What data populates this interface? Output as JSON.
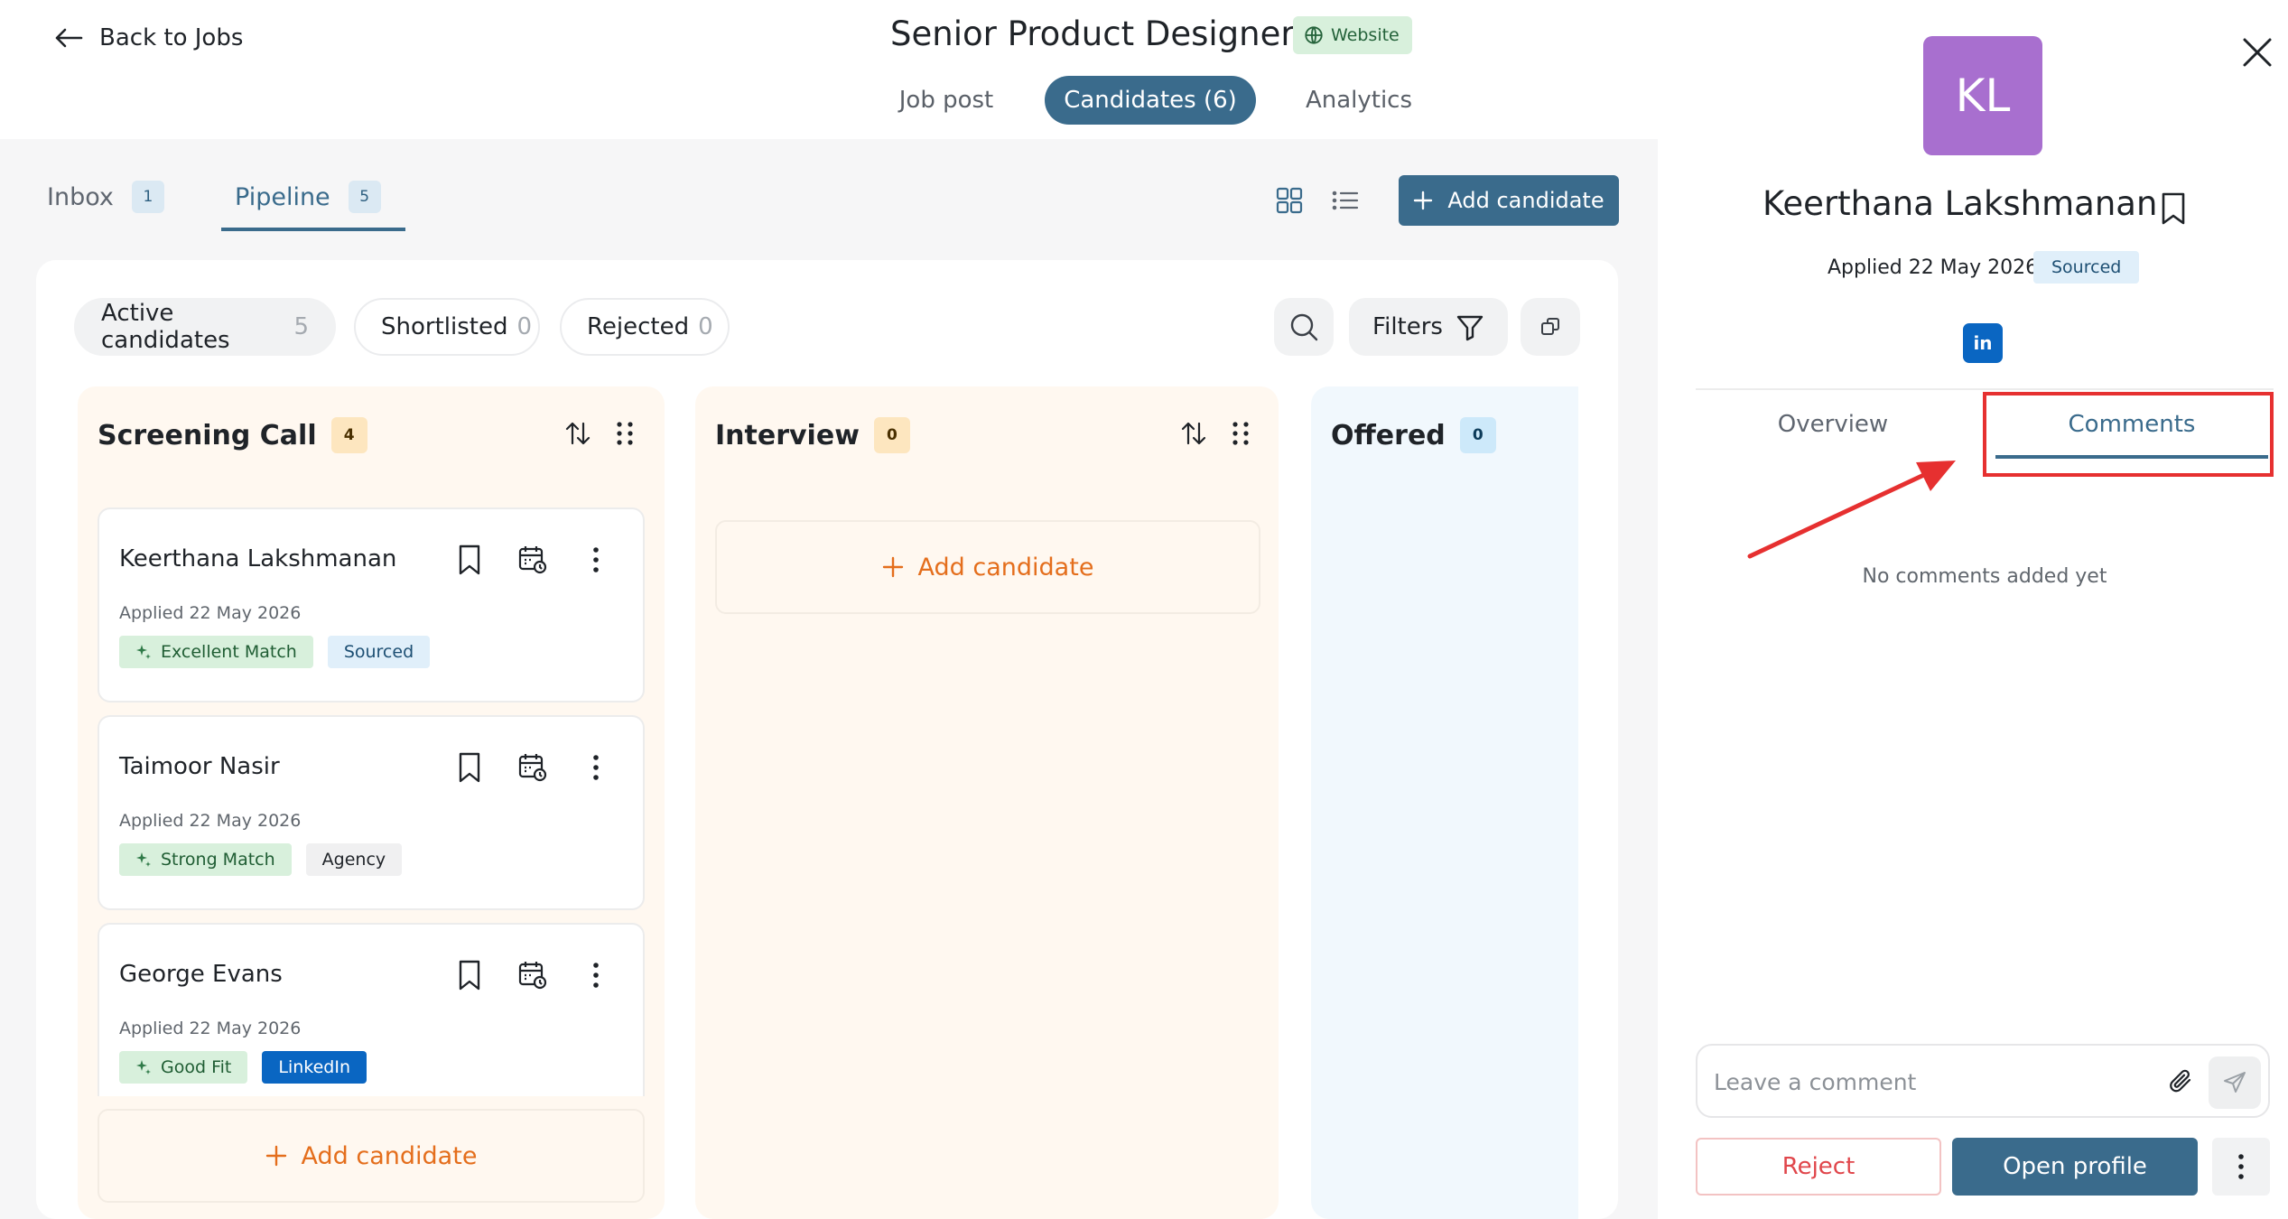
{
  "header": {
    "back_label": "Back to Jobs",
    "job_title": "Senior Product Designer",
    "source_badge": "Website",
    "tabs": [
      {
        "label": "Job post"
      },
      {
        "label": "Candidates (6)"
      },
      {
        "label": "Analytics"
      }
    ],
    "active_tab": "Candidates (6)"
  },
  "subtabs": [
    {
      "label": "Inbox",
      "count": "1"
    },
    {
      "label": "Pipeline",
      "count": "5"
    }
  ],
  "toolbar": {
    "add_candidate_label": "Add candidate"
  },
  "filter_chips": [
    {
      "label": "Active candidates",
      "count": "5"
    },
    {
      "label": "Shortlisted",
      "count": "0"
    },
    {
      "label": "Rejected",
      "count": "0"
    }
  ],
  "filters_label": "Filters",
  "columns": [
    {
      "title": "Screening Call",
      "count": "4",
      "cards": [
        {
          "name": "Keerthana Lakshmanan",
          "applied": "Applied 22 May 2026",
          "tags": [
            "Excellent Match",
            "Sourced"
          ]
        },
        {
          "name": "Taimoor Nasir",
          "applied": "Applied 22 May 2026",
          "tags": [
            "Strong Match",
            "Agency"
          ]
        },
        {
          "name": "George Evans",
          "applied": "Applied 22 May 2026",
          "tags": [
            "Good Fit",
            "LinkedIn"
          ]
        }
      ],
      "add_label": "Add candidate"
    },
    {
      "title": "Interview",
      "count": "0",
      "add_label": "Add candidate"
    },
    {
      "title": "Offered",
      "count": "0"
    }
  ],
  "detail": {
    "initials": "KL",
    "name": "Keerthana Lakshmanan",
    "applied": "Applied 22 May 2026",
    "source": "Sourced",
    "linkedin": "in",
    "tabs": [
      {
        "label": "Overview"
      },
      {
        "label": "Comments"
      }
    ],
    "active_tab": "Comments",
    "empty_comments": "No comments added yet",
    "comment_placeholder": "Leave a comment",
    "reject_label": "Reject",
    "open_profile_label": "Open profile"
  },
  "colors": {
    "primary": "#3a6b8c",
    "accent_orange": "#e46e1c",
    "avatar": "#a86fcf",
    "annotation_red": "#e63030",
    "linkedin": "#0a66c2"
  }
}
